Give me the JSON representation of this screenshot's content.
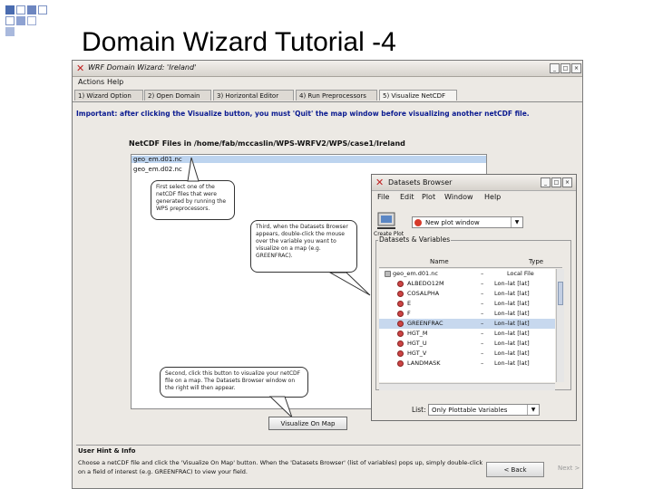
{
  "slide_title": "Domain Wizard Tutorial -4",
  "colors": {
    "bullet_square": "#4a6cb0",
    "note_text": "#0a1a90",
    "selection": "#bdd4ef"
  },
  "window": {
    "title": "WRF Domain Wizard: 'Ireland'",
    "menu": [
      "Actions",
      "Help"
    ],
    "tabs": [
      "1) Wizard Option",
      "2) Open Domain",
      "3) Horizontal Editor",
      "4) Run Preprocessors",
      "5) Visualize NetCDF"
    ],
    "active_tab": 4,
    "important_note": "Important: after clicking the Visualize button, you must 'Quit' the map window before visualizing another netCDF file.",
    "netcdf_label": "NetCDF Files in /home/fab/mccaslin/WPS-WRFV2/WPS/case1/Ireland",
    "files": [
      "geo_em.d01.nc",
      "geo_em.d02.nc"
    ],
    "selected_file": 0,
    "callouts": {
      "first": "First select one of the netCDF files that were generated by running the WPS preprocessors.",
      "third": "Third, when the Datasets Browser appears, double-click the mouse over the variable you want to visualize on a map (e.g. GREENFRAC).",
      "second": "Second, click this button to visualize your netCDF file on a map. The Datasets Browser window on the right will then appear."
    },
    "visualize_button": "Visualize On Map",
    "hint": {
      "header": "User Hint & Info",
      "body": "Choose a netCDF file and click the 'Visualize On Map' button. When the 'Datasets Browser' (list of variables) pops up, simply double-click on a field of interest (e.g. GREENFRAC) to view your field."
    },
    "back_button": "< Back",
    "next_button": "Next >"
  },
  "datasets_browser": {
    "title": "Datasets Browser",
    "menu": [
      "File",
      "Edit",
      "Plot",
      "Window",
      "Help"
    ],
    "create_plot_label": "Create Plot",
    "plot_target": "New plot window",
    "group_label": "Datasets & Variables",
    "columns": [
      "Name",
      "Type"
    ],
    "root": {
      "name": "geo_em.d01.nc",
      "dash": "–",
      "type": "Local File"
    },
    "variables": [
      {
        "name": "ALBEDO12M",
        "dash": "–",
        "type": "Lon–lat [lat]"
      },
      {
        "name": "COSALPHA",
        "dash": "–",
        "type": "Lon–lat [lat]"
      },
      {
        "name": "E",
        "dash": "–",
        "type": "Lon–lat [lat]"
      },
      {
        "name": "F",
        "dash": "–",
        "type": "Lon–lat [lat]"
      },
      {
        "name": "GREENFRAC",
        "dash": "–",
        "type": "Lon–lat [lat]"
      },
      {
        "name": "HGT_M",
        "dash": "–",
        "type": "Lon–lat [lat]"
      },
      {
        "name": "HGT_U",
        "dash": "–",
        "type": "Lon–lat [lat]"
      },
      {
        "name": "HGT_V",
        "dash": "–",
        "type": "Lon–lat [lat]"
      },
      {
        "name": "LANDMASK",
        "dash": "–",
        "type": "Lon–lat [lat]"
      }
    ],
    "selected_variable": 4,
    "list_label": "List:",
    "list_value": "Only Plottable Variables"
  }
}
